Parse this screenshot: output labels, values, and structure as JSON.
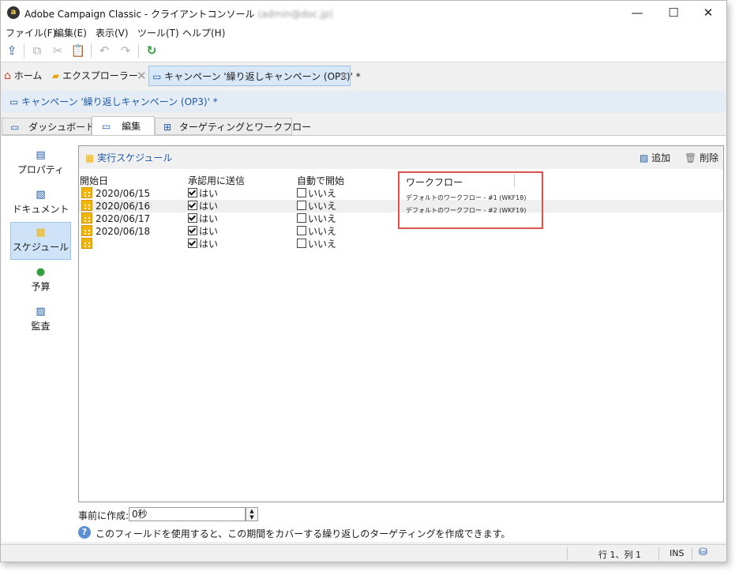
{
  "window": {
    "title": "Adobe Campaign Classic - クライアントコンソール",
    "title_user": "(admin@doc.jp)",
    "controls": {
      "minimize": "—",
      "maximize": "☐",
      "close": "✕"
    }
  },
  "menu": {
    "items": [
      "ファイル(F)",
      "編集(E)",
      "表示(V)",
      "ツール(T)",
      "ヘルプ(H)"
    ]
  },
  "toolbar": {
    "icons": [
      "connect-icon",
      "copy-icon",
      "cut-icon",
      "paste-icon",
      "undo-icon",
      "redo-icon",
      "refresh-icon"
    ]
  },
  "tabs": {
    "home": "ホーム",
    "explorer": "エクスプローラー",
    "campaign": "キャンペーン '繰り返しキャンペーン (OP3)' *"
  },
  "form": {
    "title": "キャンペーン '繰り返しキャンペーン (OP3)' *",
    "subtabs": [
      "ダッシュボード",
      "編集",
      "ターゲティングとワークフロー"
    ],
    "active_subtab": "編集"
  },
  "leftnav": {
    "items": [
      {
        "label": "プロパティ",
        "icon": "properties-icon"
      },
      {
        "label": "ドキュメント",
        "icon": "document-icon"
      },
      {
        "label": "スケジュール",
        "icon": "calendar-icon"
      },
      {
        "label": "予算",
        "icon": "budget-icon"
      },
      {
        "label": "監査",
        "icon": "audit-icon"
      }
    ],
    "active": "スケジュール"
  },
  "schedule": {
    "title": "実行スケジュール",
    "add_label": "追加",
    "delete_label": "削除",
    "columns": [
      "開始日",
      "承認用に送信",
      "自動で開始",
      "ワークフロー"
    ],
    "rows": [
      {
        "date": "2020/06/15",
        "approval": "はい",
        "approval_checked": true,
        "autostart": "いいえ",
        "autostart_checked": false
      },
      {
        "date": "2020/06/16",
        "approval": "はい",
        "approval_checked": true,
        "autostart": "いいえ",
        "autostart_checked": false
      },
      {
        "date": "2020/06/17",
        "approval": "はい",
        "approval_checked": true,
        "autostart": "いいえ",
        "autostart_checked": false
      },
      {
        "date": "2020/06/18",
        "approval": "はい",
        "approval_checked": true,
        "autostart": "いいえ",
        "autostart_checked": false
      },
      {
        "date": "",
        "approval": "はい",
        "approval_checked": true,
        "autostart": "いいえ",
        "autostart_checked": false
      }
    ],
    "workflows": [
      "デフォルトのワークフロー - #1 (WKF18)",
      "デフォルトのワークフロー - #2 (WKF19)"
    ],
    "highlight_color": "#d9534f"
  },
  "precreate": {
    "label": "事前に作成:",
    "value": "0秒"
  },
  "help": {
    "text": "このフィールドを使用すると、この期間をカバーする繰り返しのターゲティングを作成できます。"
  },
  "status": {
    "position": "行 1、列 1",
    "mode": "INS"
  },
  "colors": {
    "accent": "#1e5aa8",
    "active_tab_bg": "#d9e8f8",
    "calendar": "#f4b400"
  }
}
